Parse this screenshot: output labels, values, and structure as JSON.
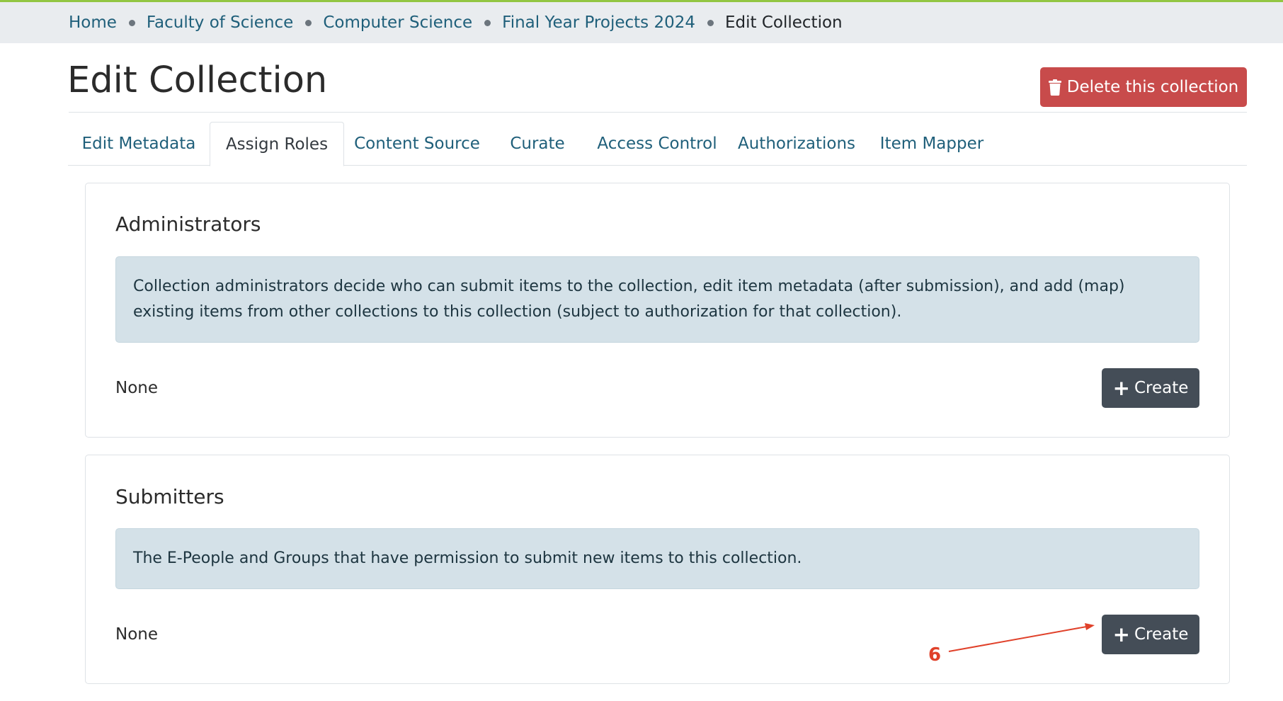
{
  "breadcrumb": {
    "items": [
      "Home",
      "Faculty of Science",
      "Computer Science",
      "Final Year Projects 2024"
    ],
    "current": "Edit Collection"
  },
  "page": {
    "title": "Edit Collection",
    "delete_label": "Delete this collection",
    "delete_icon": "trash-icon"
  },
  "tabs": [
    {
      "label": "Edit Metadata",
      "active": false
    },
    {
      "label": "Assign Roles",
      "active": true
    },
    {
      "label": "Content Source",
      "active": false
    },
    {
      "label": "Curate",
      "active": false
    },
    {
      "label": "Access Control",
      "active": false
    },
    {
      "label": "Authorizations",
      "active": false
    },
    {
      "label": "Item Mapper",
      "active": false
    }
  ],
  "roles": [
    {
      "title": "Administrators",
      "description": "Collection administrators decide who can submit items to the collection, edit item metadata (after submission), and add (map) existing items from other collections to this collection (subject to authorization for that collection).",
      "members": "None",
      "create_label": "Create"
    },
    {
      "title": "Submitters",
      "description": "The E-People and Groups that have permission to submit new items to this collection.",
      "members": "None",
      "create_label": "Create"
    }
  ],
  "annotation": {
    "number": "6",
    "color": "#e0412a"
  },
  "colors": {
    "accent_bar": "#92c642",
    "link": "#1f5f7a",
    "danger": "#c84b4b",
    "dark_button": "#444d57",
    "info_bg": "#d4e1e8"
  }
}
